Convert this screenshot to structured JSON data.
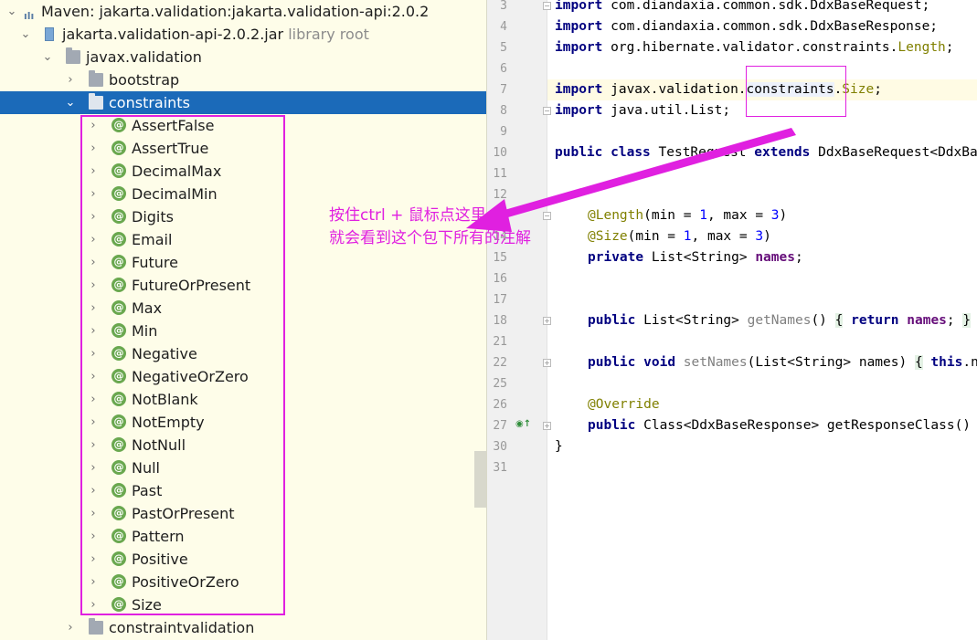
{
  "tree": {
    "root": {
      "label": "Maven: jakarta.validation:jakarta.validation-api:2.0.2"
    },
    "jar": {
      "label": "jakarta.validation-api-2.0.2.jar",
      "suffix": "library root"
    },
    "package": {
      "label": "javax.validation"
    },
    "bootstrap": {
      "label": "bootstrap"
    },
    "constraints": {
      "label": "constraints"
    },
    "constraint_classes": [
      "AssertFalse",
      "AssertTrue",
      "DecimalMax",
      "DecimalMin",
      "Digits",
      "Email",
      "Future",
      "FutureOrPresent",
      "Max",
      "Min",
      "Negative",
      "NegativeOrZero",
      "NotBlank",
      "NotEmpty",
      "NotNull",
      "Null",
      "Past",
      "PastOrPresent",
      "Pattern",
      "Positive",
      "PositiveOrZero",
      "Size"
    ],
    "constraintvalidation": {
      "label": "constraintvalidation"
    }
  },
  "editor": {
    "line_numbers": [
      "3",
      "4",
      "5",
      "6",
      "7",
      "8",
      "9",
      "10",
      "11",
      "12",
      "13",
      "14",
      "15",
      "16",
      "17",
      "18",
      "21",
      "22",
      "25",
      "26",
      "27",
      "30",
      "31"
    ],
    "lines": {
      "l3": {
        "kw": "import",
        "rest": " com.diandaxia.common.sdk.DdxBaseRequest;"
      },
      "l4": {
        "kw": "import",
        "rest": " com.diandaxia.common.sdk.DdxBaseResponse;"
      },
      "l5": {
        "kw": "import",
        "rest": " org.hibernate.validator.constraints.",
        "cls": "Length",
        "end": ";"
      },
      "l7": {
        "kw": "import",
        "a": " javax.validation.",
        "b": "constraints",
        "c": ".",
        "cls": "Size",
        "end": ";"
      },
      "l8": {
        "kw": "import",
        "rest": " java.util.List;"
      },
      "l10": {
        "kw1": "public",
        "kw2": "class",
        "a": " TestRequest ",
        "kw3": "extends",
        "b": " DdxBaseRequest<DdxBaseResponse> {"
      },
      "l13": {
        "ann": "@Length",
        "a": "(min = ",
        "n1": "1",
        "b": ", max = ",
        "n2": "3",
        "c": ")"
      },
      "l14": {
        "ann": "@Size",
        "a": "(min = ",
        "n1": "1",
        "b": ", max = ",
        "n2": "3",
        "c": ")"
      },
      "l15": {
        "kw": "private",
        "a": " List<String> ",
        "fld": "names",
        "b": ";"
      },
      "l18": {
        "kw": "public",
        "a": " List<String> ",
        "m": "getNames",
        "b": "() ",
        "br1": "{",
        "kw2": "return",
        "fld": "names",
        "c": "; ",
        "br2": "}"
      },
      "l22": {
        "kw1": "public",
        "kw2": "void",
        "m": "setNames",
        "a": "(List<String> names) ",
        "br1": "{",
        "kw3": "this",
        "b": ".names = names; }"
      },
      "l26": {
        "ann": "@Override"
      },
      "l27": {
        "kw": "public",
        "a": " Class<DdxBaseResponse> getResponseClass() { ... }"
      },
      "l30": {
        "a": "}"
      }
    }
  },
  "annotation_note": {
    "line1": "按住ctrl + 鼠标点这里",
    "line2": "就会看到这个包下所有的注解"
  },
  "colors": {
    "highlight": "#e020e0",
    "selection": "#1b6ab9",
    "tree_bg": "#fefde9"
  }
}
